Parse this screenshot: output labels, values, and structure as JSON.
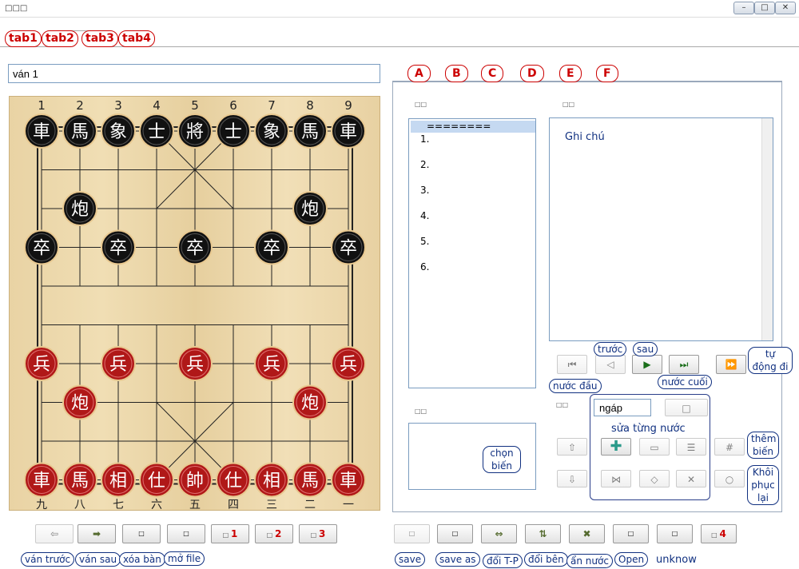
{
  "window": {
    "title": "□□□"
  },
  "top_tabs": [
    {
      "label": "tab1"
    },
    {
      "label": "tab2"
    },
    {
      "label": "tab3"
    },
    {
      "label": "tab4"
    }
  ],
  "game_title": "ván 1",
  "right_tabs": [
    {
      "label": "A"
    },
    {
      "label": "B"
    },
    {
      "label": "C"
    },
    {
      "label": "D"
    },
    {
      "label": "E"
    },
    {
      "label": "F"
    }
  ],
  "movelist": {
    "header": "========",
    "moves": [
      "1.",
      "2.",
      "3.",
      "4.",
      "5.",
      "6."
    ]
  },
  "notes": {
    "text": "Ghi chú"
  },
  "edit": {
    "input_value": "ngáp",
    "label": "sửa từng nước"
  },
  "board": {
    "top_numbers": [
      "1",
      "2",
      "3",
      "4",
      "5",
      "6",
      "7",
      "8",
      "9"
    ],
    "bottom_numbers": [
      "九",
      "八",
      "七",
      "六",
      "五",
      "四",
      "三",
      "二",
      "一"
    ],
    "black_back": [
      "車",
      "馬",
      "象",
      "士",
      "將",
      "士",
      "象",
      "馬",
      "車"
    ],
    "black_cannon": "炮",
    "black_pawn": "卒",
    "red_back": [
      "車",
      "馬",
      "相",
      "仕",
      "帥",
      "仕",
      "相",
      "馬",
      "車"
    ],
    "red_cannon": "炮",
    "red_pawn": "兵"
  },
  "callouts": {
    "prev": "trước",
    "next": "sau",
    "first": "nước đầu",
    "last": "nước cuối",
    "auto": "tự động đi",
    "choose_var": "chọn biến",
    "add_var": "thêm biến",
    "restore": "Khôi phục lại",
    "prev_game": "ván trước",
    "next_game": "ván sau",
    "clear_board": "xóa bàn",
    "open_file": "mở file",
    "save": "save",
    "save_as": "save as",
    "swap_tp": "đổi T-P",
    "swap_side": "đổi bên",
    "hide_moves": "ẩn nước",
    "open": "Open",
    "unknow": "unknow"
  },
  "bottom_buttons": {
    "b1": "1",
    "b2": "2",
    "b3": "3",
    "b4": "4"
  },
  "colors": {
    "red_label": "#cc0000",
    "callout": "#103080",
    "board": "#ecd6a8"
  }
}
